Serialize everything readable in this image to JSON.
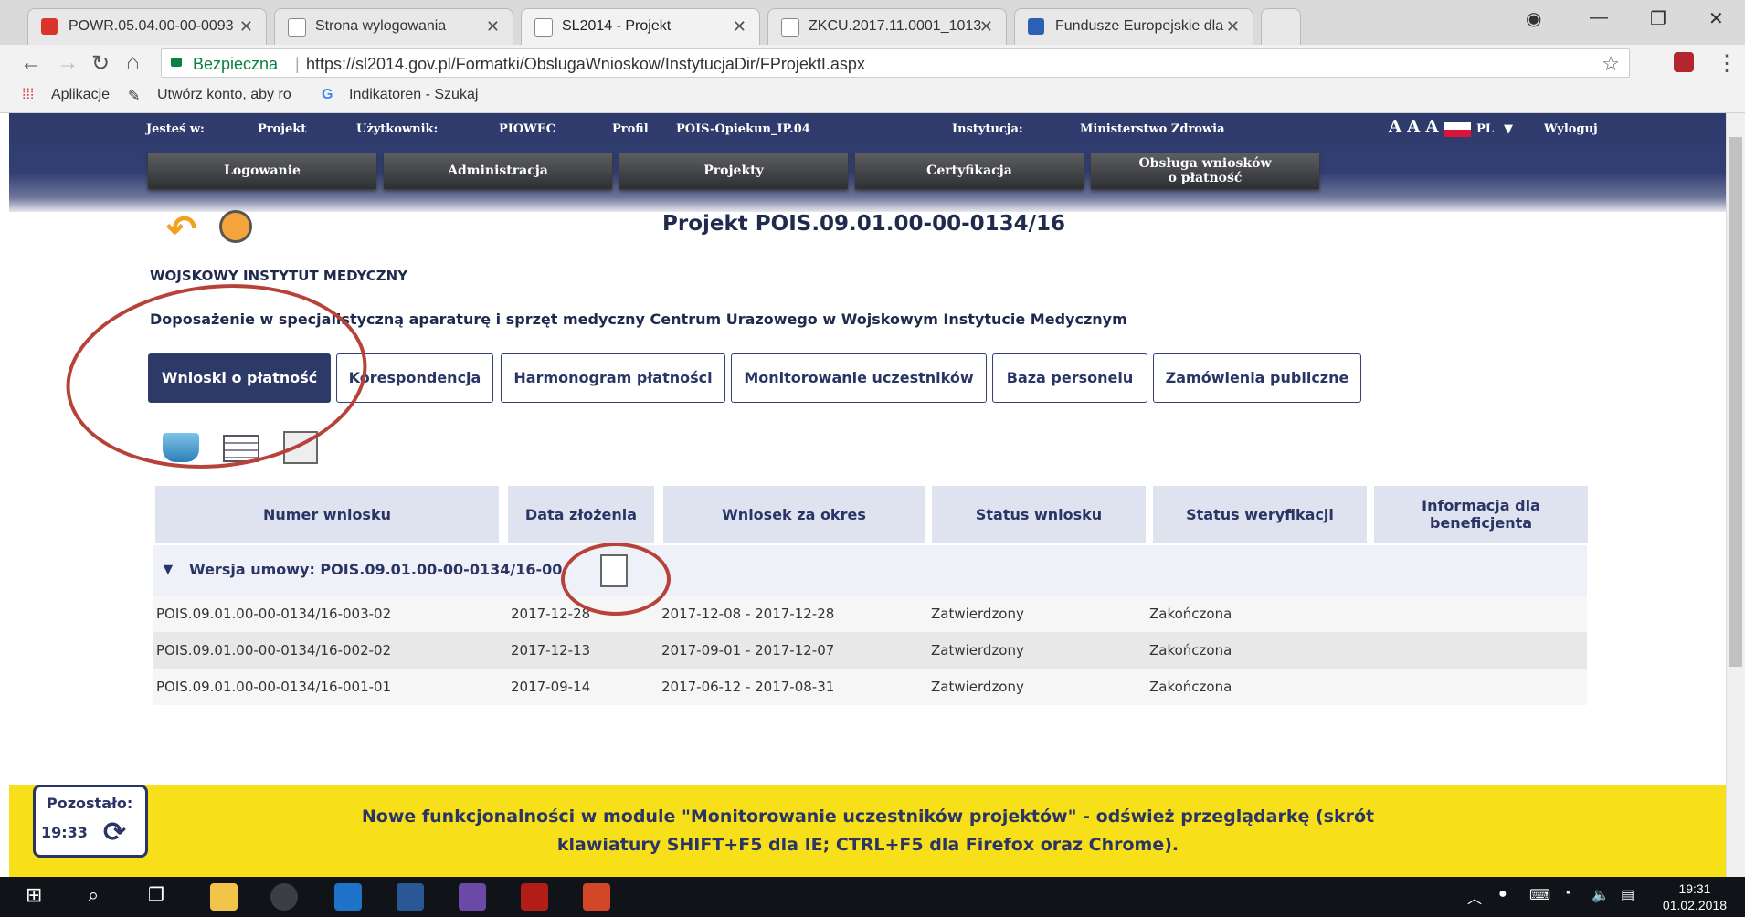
{
  "browser": {
    "tabs": [
      {
        "title": "POWR.05.04.00-00-0093",
        "active": false
      },
      {
        "title": "Strona wylogowania",
        "active": false
      },
      {
        "title": "SL2014 - Projekt",
        "active": true
      },
      {
        "title": "ZKCU.2017.11.0001_1013",
        "active": false
      },
      {
        "title": "Fundusze Europejskie dla",
        "active": false
      }
    ],
    "secure_label": "Bezpieczna",
    "url": "https://sl2014.gov.pl/Formatki/ObslugaWnioskow/InstytucjaDir/FProjektI.aspx",
    "bookmarks": [
      "Aplikacje",
      "Utwórz konto, aby ro",
      "Indikatoren - Szukaj"
    ]
  },
  "header": {
    "location_label": "Jesteś w:",
    "location_value": "Projekt",
    "user_label": "Użytkownik:",
    "user_value": "PIOWEC",
    "profile_label": "Profil",
    "profile_value": "POIS-Opiekun_IP.04",
    "institution_label": "Instytucja:",
    "institution_value": "Ministerstwo Zdrowia",
    "font_size_controls": "A A A",
    "language": "PL",
    "logout": "Wyloguj",
    "menu": [
      "Logowanie",
      "Administracja",
      "Projekty",
      "Certyfikacja"
    ],
    "menu_last_line1": "Obsługa wniosków",
    "menu_last_line2": "o płatność"
  },
  "project": {
    "title": "Projekt POIS.09.01.00-00-0134/16",
    "institution": "WOJSKOWY INSTYTUT MEDYCZNY",
    "description": "Doposażenie w specjalistyczną aparaturę i sprzęt medyczny Centrum Urazowego w Wojskowym Instytucie Medycznym"
  },
  "project_tabs": [
    "Wnioski o płatność",
    "Korespondencja",
    "Harmonogram płatności",
    "Monitorowanie uczestników",
    "Baza personelu",
    "Zamówienia publiczne"
  ],
  "table": {
    "headers": [
      "Numer wniosku",
      "Data złożenia",
      "Wniosek za okres",
      "Status wniosku",
      "Status weryfikacji",
      "Informacja dla beneficjenta"
    ],
    "group_label": "Wersja umowy: POIS.09.01.00-00-0134/16-00",
    "rows": [
      {
        "numer": "POIS.09.01.00-00-0134/16-003-02",
        "data": "2017-12-28",
        "okres": "2017-12-08 - 2017-12-28",
        "status": "Zatwierdzony",
        "weryfikacja": "Zakończona"
      },
      {
        "numer": "POIS.09.01.00-00-0134/16-002-02",
        "data": "2017-12-13",
        "okres": "2017-09-01 - 2017-12-07",
        "status": "Zatwierdzony",
        "weryfikacja": "Zakończona"
      },
      {
        "numer": "POIS.09.01.00-00-0134/16-001-01",
        "data": "2017-09-14",
        "okres": "2017-06-12 - 2017-08-31",
        "status": "Zatwierdzony",
        "weryfikacja": "Zakończona"
      }
    ]
  },
  "footer": {
    "timer_label": "Pozostało:",
    "timer_value": "19:33",
    "notice_line1": "Nowe funkcjonalności w module \"Monitorowanie uczestników projektów\" - odśwież przeglądarkę (skrót",
    "notice_line2": "klawiatury SHIFT+F5 dla IE; CTRL+F5 dla Firefox oraz Chrome)."
  },
  "taskbar": {
    "time": "19:31",
    "date": "01.02.2018"
  },
  "colors": {
    "navy": "#2d3a68",
    "annotation": "#b7423a",
    "footer": "#f7e01a"
  }
}
